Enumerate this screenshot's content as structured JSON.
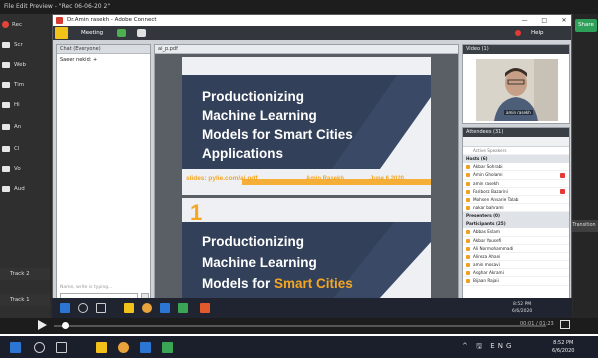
{
  "recorder": {
    "title": "File  Edit  Preview - \"Rec 06-06-20 2\"",
    "window_controls": [
      "—",
      "□",
      "✕"
    ],
    "left_tools": [
      {
        "icon": "record-icon",
        "label": "Rec"
      },
      {
        "icon": "screen-icon",
        "label": "Scr"
      },
      {
        "icon": "webcam-icon",
        "label": "Web"
      },
      {
        "icon": "monitor-icon",
        "label": "Tim"
      },
      {
        "icon": "cursor-icon",
        "label": "Hi"
      },
      {
        "icon": "arrow-icon",
        "label": "An"
      },
      {
        "icon": "caption-icon",
        "label": "Cl"
      },
      {
        "icon": "mic-icon",
        "label": "Vo"
      },
      {
        "icon": "audio-icon",
        "label": "Aud"
      }
    ],
    "share_button": "Share",
    "callout": "Transition",
    "tracks": [
      "Track 2",
      "Track 1"
    ],
    "timeline_time": "00:01 / 01:23"
  },
  "adobe_connect": {
    "title": "Dr.Amin rasekh - Adobe Connect",
    "window_controls": [
      "—",
      "□",
      "✕"
    ],
    "menu": {
      "meeting": "Meeting",
      "help": "Help"
    },
    "chat": {
      "header": "Chat (Everyone)",
      "messages": [
        "Saeer nekid: +"
      ],
      "typing_placeholder": "Name, write is typing...",
      "tab": "Everyone"
    },
    "share_pod": {
      "header": "ai_p.pdf"
    },
    "slide1": {
      "title_lines": [
        "Productionizing",
        "Machine Learning",
        "Models for Smart Cities",
        "Applications"
      ],
      "link": "slides: pylie.com/ai.pdf",
      "author": "Amin Rasekh",
      "date": "June 6 2020"
    },
    "slide2": {
      "number": "1",
      "title_lines": [
        "Productionizing",
        "Machine Learning"
      ],
      "line3_prefix": "Models for ",
      "line3_highlight": "Smart Cities"
    },
    "video": {
      "header": "Video (1)",
      "caption": "amin rasekh"
    },
    "attendees": {
      "header": "Attendees (31)",
      "active_speaker": "Active Speakers",
      "hosts_label": "Hosts (6)",
      "hosts": [
        "Akbar Sohrabi",
        "Amin Gholami",
        "amin rasekh",
        "Fariborz Bazarini",
        "Mohsen Ansarie Talab",
        "nakar bahrami"
      ],
      "presenters_label": "Presenters (0)",
      "participants_label": "Participants (25)",
      "participants": [
        "Abbas Eslam",
        "Akbar Yousefi",
        "Ali Normohammadi",
        "Alireza Ahani",
        "amin mosavi",
        "Asghar Akrami",
        "Bijaan Rajaii"
      ]
    },
    "inner_taskbar_time": [
      "8:52 PM",
      "6/6/2020"
    ]
  },
  "outer_taskbar": {
    "time": [
      "8:52 PM",
      "6/6/2020"
    ],
    "tray": "^ 🖫 ENG"
  },
  "colors": {
    "slide_dark": "#32405a",
    "accent_orange": "#f5a623"
  }
}
